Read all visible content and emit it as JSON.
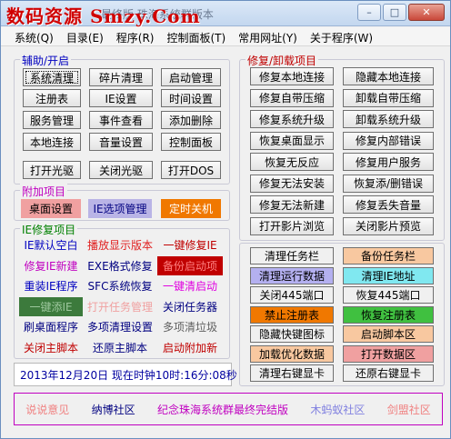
{
  "titlebar": {
    "watermark": "数码资源 Smzy.Com",
    "title": "最终版 珠海系统群版本",
    "minimize": "–",
    "maximize": "□",
    "close": "✕"
  },
  "menu": [
    "系统(Q)",
    "目录(E)",
    "程序(R)",
    "控制面板(T)",
    "常用网址(Y)",
    "关于程序(W)"
  ],
  "assist": {
    "title": "辅助/开启",
    "buttons": [
      "系统清理",
      "碎片清理",
      "启动管理",
      "注册表",
      "IE设置",
      "时间设置",
      "服务管理",
      "事件查看",
      "添加删除",
      "本地连接",
      "音量设置",
      "控制面板"
    ],
    "drive_buttons": [
      "打开光驱",
      "关闭光驱",
      "打开DOS"
    ]
  },
  "extra": {
    "title": "附加项目",
    "items": [
      {
        "label": "桌面设置",
        "bg": "#f0a0a0",
        "fg": "#000000"
      },
      {
        "label": "IE选项管理",
        "bg": "#b9b4e6",
        "fg": "#000080"
      },
      {
        "label": "定时关机",
        "bg": "#f07800",
        "fg": "#ffffff"
      }
    ]
  },
  "ie": {
    "title": "IE修复项目",
    "items": [
      {
        "label": "IE默认空白",
        "bg": "#f0f0f0",
        "fg": "#0000c0"
      },
      {
        "label": "播放显示版本",
        "bg": "#f0f0f0",
        "fg": "#e02020"
      },
      {
        "label": "一键修复IE",
        "bg": "#f0f0f0",
        "fg": "#c00000"
      },
      {
        "label": "修复IE新建",
        "bg": "#f0f0f0",
        "fg": "#c000c0"
      },
      {
        "label": "EXE格式修复",
        "bg": "#f0f0f0",
        "fg": "#000080"
      },
      {
        "label": "备份启动项",
        "bg": "#c00000",
        "fg": "#ff8080"
      },
      {
        "label": "重装IE程序",
        "bg": "#f0f0f0",
        "fg": "#0000c0"
      },
      {
        "label": "SFC系统恢复",
        "bg": "#f0f0f0",
        "fg": "#000080"
      },
      {
        "label": "一键清启动",
        "bg": "#f0f0f0",
        "fg": "#e000e0"
      },
      {
        "label": "一键添IE",
        "bg": "#3c7a3c",
        "fg": "#9ec89e"
      },
      {
        "label": "打开任务管理",
        "bg": "#f0f0f0",
        "fg": "#f0a0a0"
      },
      {
        "label": "关闭任务器",
        "bg": "#f0f0f0",
        "fg": "#000080"
      },
      {
        "label": "刷桌面程序",
        "bg": "#f0f0f0",
        "fg": "#000080"
      },
      {
        "label": "多项清理设置",
        "bg": "#f0f0f0",
        "fg": "#000080"
      },
      {
        "label": "多项清垃圾",
        "bg": "#f0f0f0",
        "fg": "#606060"
      },
      {
        "label": "关闭主脚本",
        "bg": "#f0f0f0",
        "fg": "#c00000"
      },
      {
        "label": "还原主脚本",
        "bg": "#f0f0f0",
        "fg": "#000080"
      },
      {
        "label": "启动附加新",
        "bg": "#f0f0f0",
        "fg": "#c00000"
      }
    ]
  },
  "repair": {
    "title": "修复/卸载项目",
    "buttons": [
      "修复本地连接",
      "隐藏本地连接",
      "修复自带压缩",
      "卸载自带压缩",
      "修复系统升级",
      "卸载系统升级",
      "恢复桌面显示",
      "修复内部错误",
      "恢复无反应",
      "修复用户服务",
      "修复无法安装",
      "恢复添/删错误",
      "修复无法新建",
      "修复丢失音量",
      "打开影片浏览",
      "关闭影片预览"
    ]
  },
  "backup": {
    "items": [
      {
        "label": "清理任务栏",
        "bg": "#f0f0f0",
        "fg": "#000000"
      },
      {
        "label": "备份任务栏",
        "bg": "#f8c8a0",
        "fg": "#000000"
      },
      {
        "label": "清理运行数据",
        "bg": "#b4b0f0",
        "fg": "#000000"
      },
      {
        "label": "清理IE地址",
        "bg": "#80e8f0",
        "fg": "#000000"
      },
      {
        "label": "关闭445端口",
        "bg": "#f0f0f0",
        "fg": "#000000"
      },
      {
        "label": "恢复445端口",
        "bg": "#f0f0f0",
        "fg": "#000000"
      },
      {
        "label": "禁止注册表",
        "bg": "#f07800",
        "fg": "#000000"
      },
      {
        "label": "恢复注册表",
        "bg": "#40c040",
        "fg": "#000000"
      },
      {
        "label": "隐藏快键图标",
        "bg": "#f0f0f0",
        "fg": "#000000"
      },
      {
        "label": "启动脚本区",
        "bg": "#f8c8a0",
        "fg": "#000000"
      },
      {
        "label": "加载优化数据",
        "bg": "#f8c8a0",
        "fg": "#000000"
      },
      {
        "label": "打开数据区",
        "bg": "#f0a0a0",
        "fg": "#000000"
      },
      {
        "label": "清理右键显卡",
        "bg": "#f0f0f0",
        "fg": "#000000"
      },
      {
        "label": "还原右键显卡",
        "bg": "#f0f0f0",
        "fg": "#000000"
      }
    ]
  },
  "status": {
    "datetime": "2013年12月20日  现在时钟10时:16分:08秒"
  },
  "footer": {
    "links": [
      {
        "label": "说说意见",
        "color": "#f08080"
      },
      {
        "label": "纳博社区",
        "color": "#000080"
      },
      {
        "label": "纪念珠海系统群最终完结版",
        "color": "#c000c0"
      },
      {
        "label": "木蚂蚁社区",
        "color": "#8080e0"
      },
      {
        "label": "剑盟社区",
        "color": "#f08080"
      }
    ]
  }
}
